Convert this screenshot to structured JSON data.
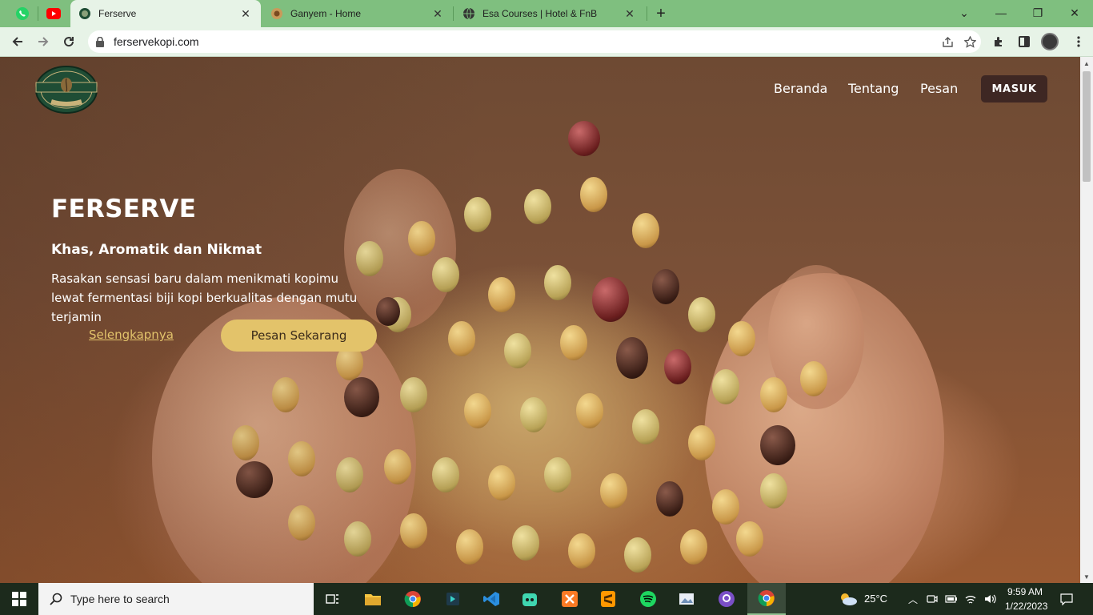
{
  "browser": {
    "tabs": [
      {
        "title": "Ferserve",
        "icon": "ferserve-favicon",
        "active": true
      },
      {
        "title": "Ganyem - Home",
        "icon": "ganyem-favicon",
        "active": false
      },
      {
        "title": "Esa Courses | Hotel & FnB",
        "icon": "globe-icon",
        "active": false
      }
    ],
    "pinned_tabs": [
      "whatsapp-icon",
      "youtube-icon"
    ],
    "close_glyph": "✕",
    "new_tab_glyph": "+",
    "window_controls": {
      "minimize": "—",
      "restore": "❐",
      "close": "✕",
      "tab_search": "⌄"
    },
    "url": "ferservekopi.com"
  },
  "site": {
    "nav": {
      "home": "Beranda",
      "about": "Tentang",
      "order": "Pesan",
      "login": "MASUK"
    },
    "hero": {
      "title": "FERSERVE",
      "subtitle": "Khas, Aromatik dan Nikmat",
      "description": "Rasakan sensasi baru dalam menikmati kopimu lewat fermentasi biji kopi berkualitas dengan mutu terjamin",
      "link_more": "Selengkapnya",
      "order_button": "Pesan Sekarang"
    },
    "logo_text": "FERSERVE",
    "accent": "#e3c36a",
    "login_bg": "#3e2723"
  },
  "taskbar": {
    "search_placeholder": "Type here to search",
    "weather": "25°C",
    "time": "9:59 AM",
    "date": "1/22/2023",
    "apps": [
      "task-view-icon",
      "file-explorer-icon",
      "chrome-icon",
      "app-store-icon",
      "vscode-icon",
      "bot-app-icon",
      "xampp-icon",
      "sublime-icon",
      "spotify-icon",
      "photo-app-icon",
      "github-icon",
      "chrome-active-icon"
    ]
  }
}
